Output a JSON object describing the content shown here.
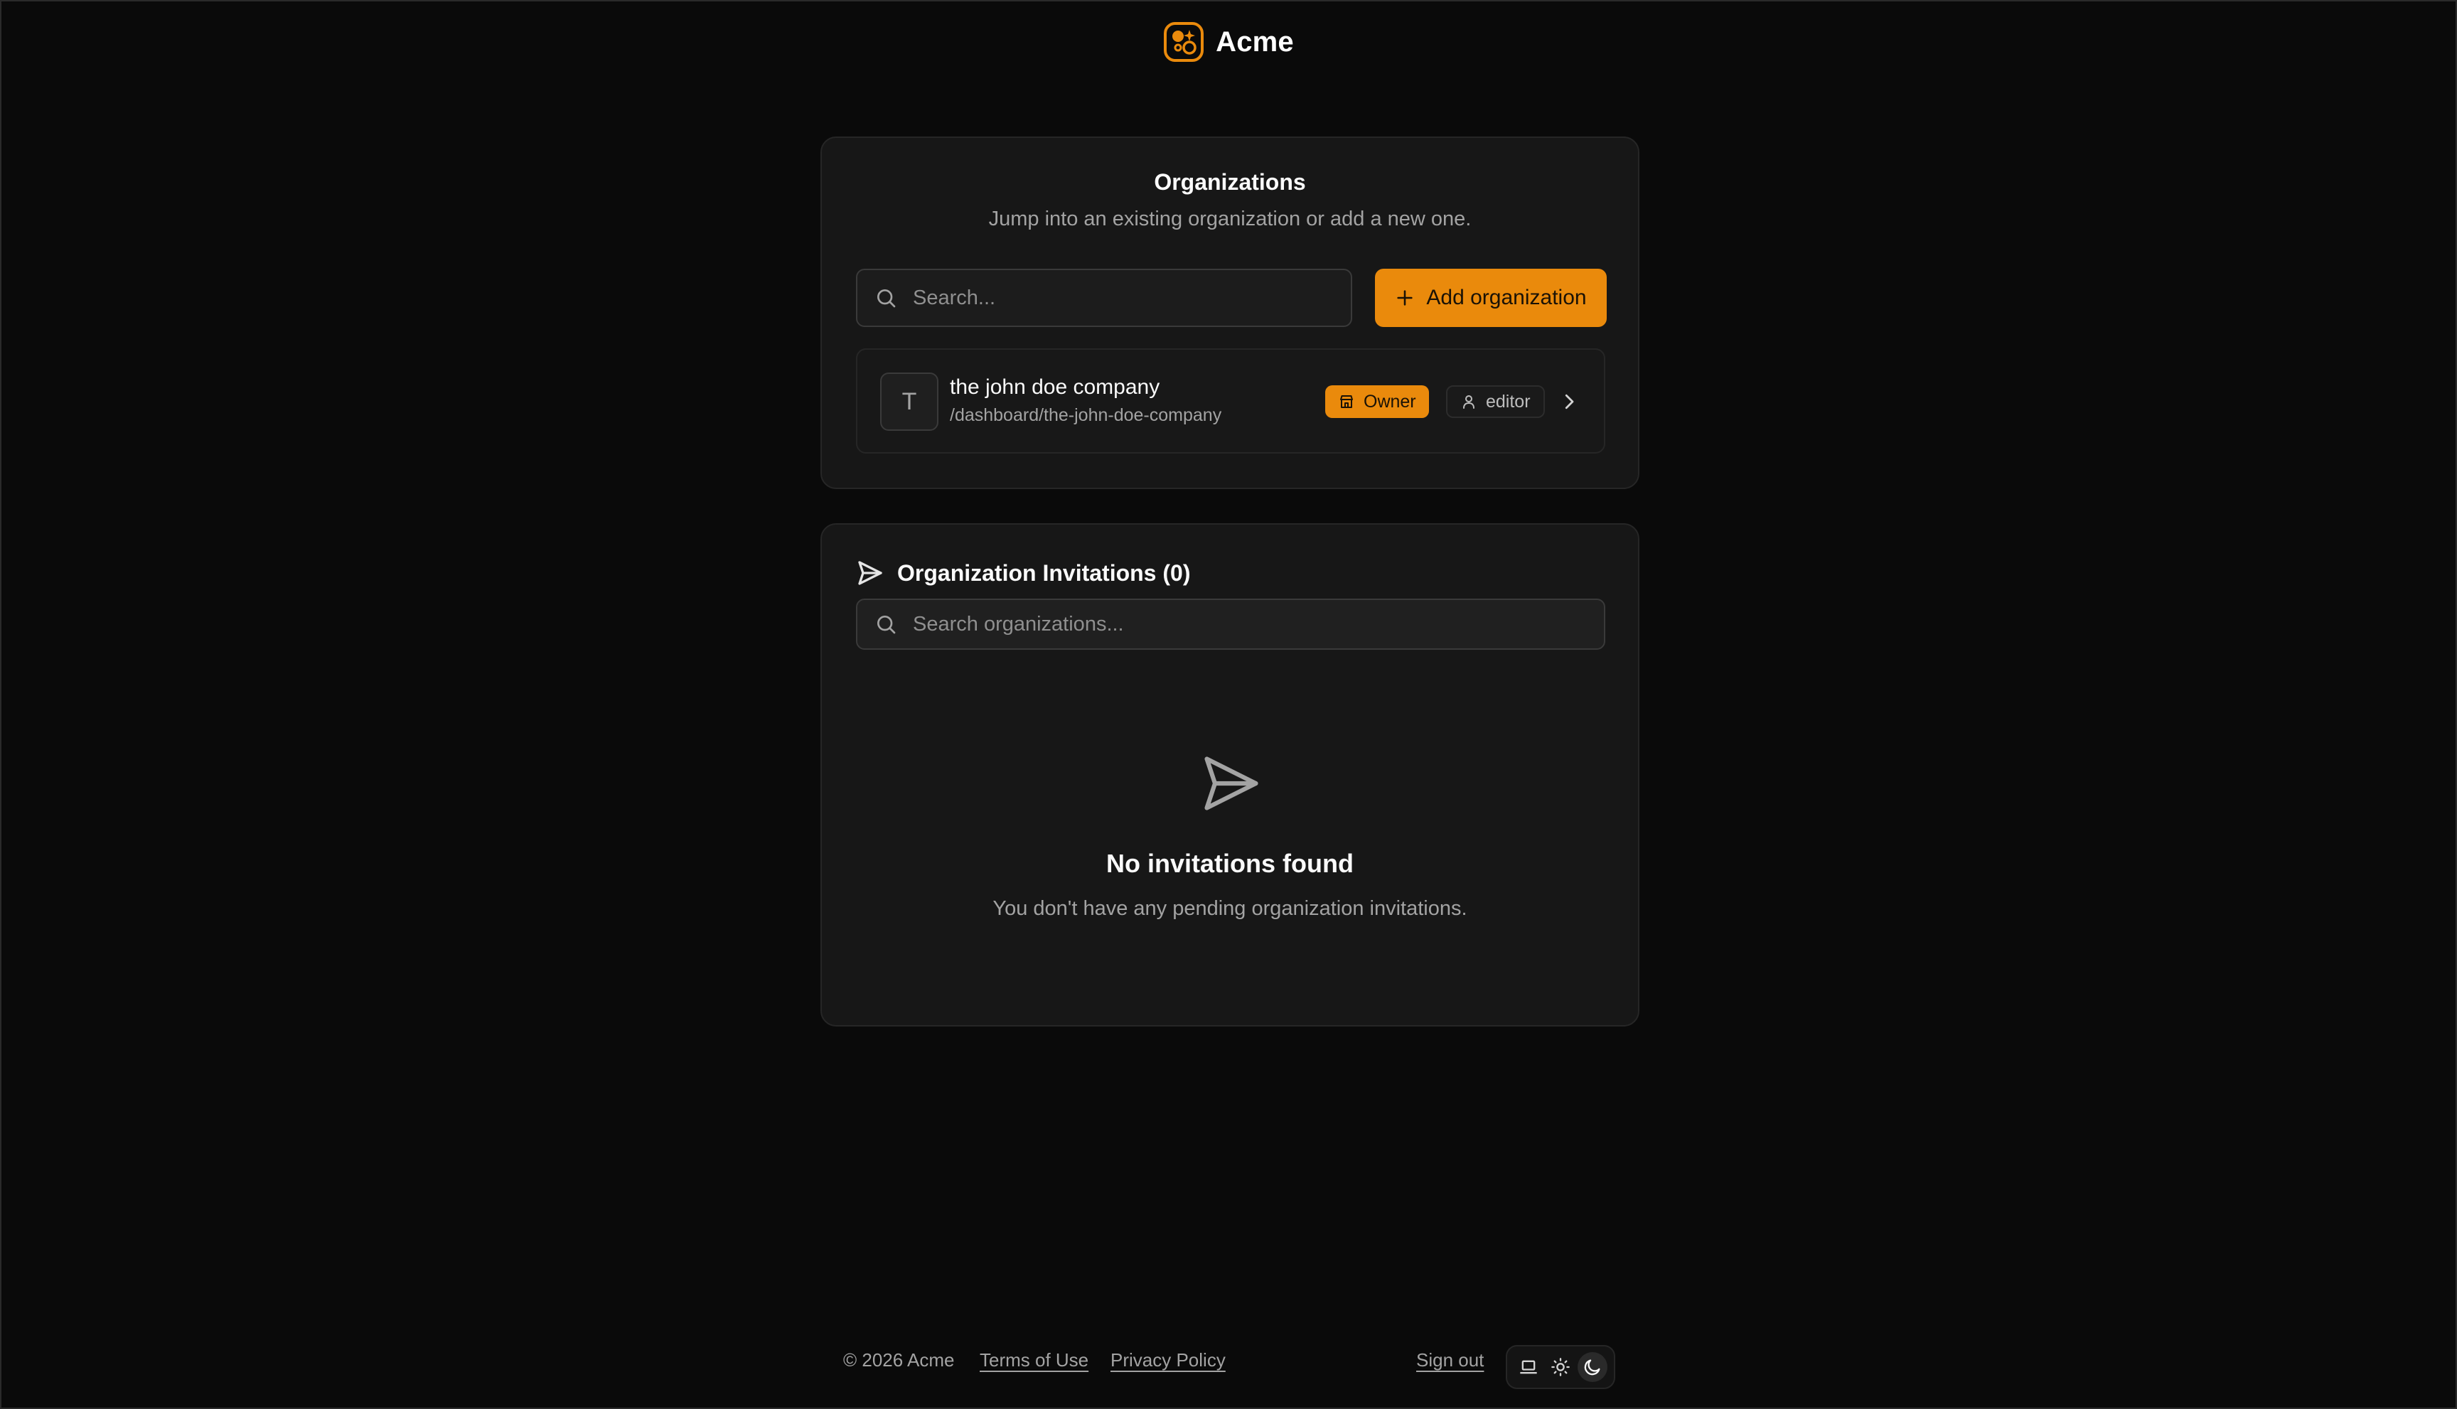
{
  "brand": {
    "name": "Acme",
    "accent": "#ea8a0c"
  },
  "organizations": {
    "title": "Organizations",
    "subtitle": "Jump into an existing organization or add a new one.",
    "search_placeholder": "Search...",
    "add_button_label": "Add organization",
    "items": [
      {
        "initial": "T",
        "name": "the john doe company",
        "path": "/dashboard/the-john-doe-company",
        "owner_badge": "Owner",
        "role_badge": "editor"
      }
    ]
  },
  "invitations": {
    "title": "Organization Invitations (0)",
    "search_placeholder": "Search organizations...",
    "empty_title": "No invitations found",
    "empty_description": "You don't have any pending organization invitations."
  },
  "footer": {
    "copyright": "© 2026 Acme",
    "terms_label": "Terms of Use",
    "privacy_label": "Privacy Policy",
    "signout_label": "Sign out",
    "theme_options": [
      "laptop-icon",
      "sun-icon",
      "moon-icon"
    ],
    "active_theme": "moon-icon"
  }
}
